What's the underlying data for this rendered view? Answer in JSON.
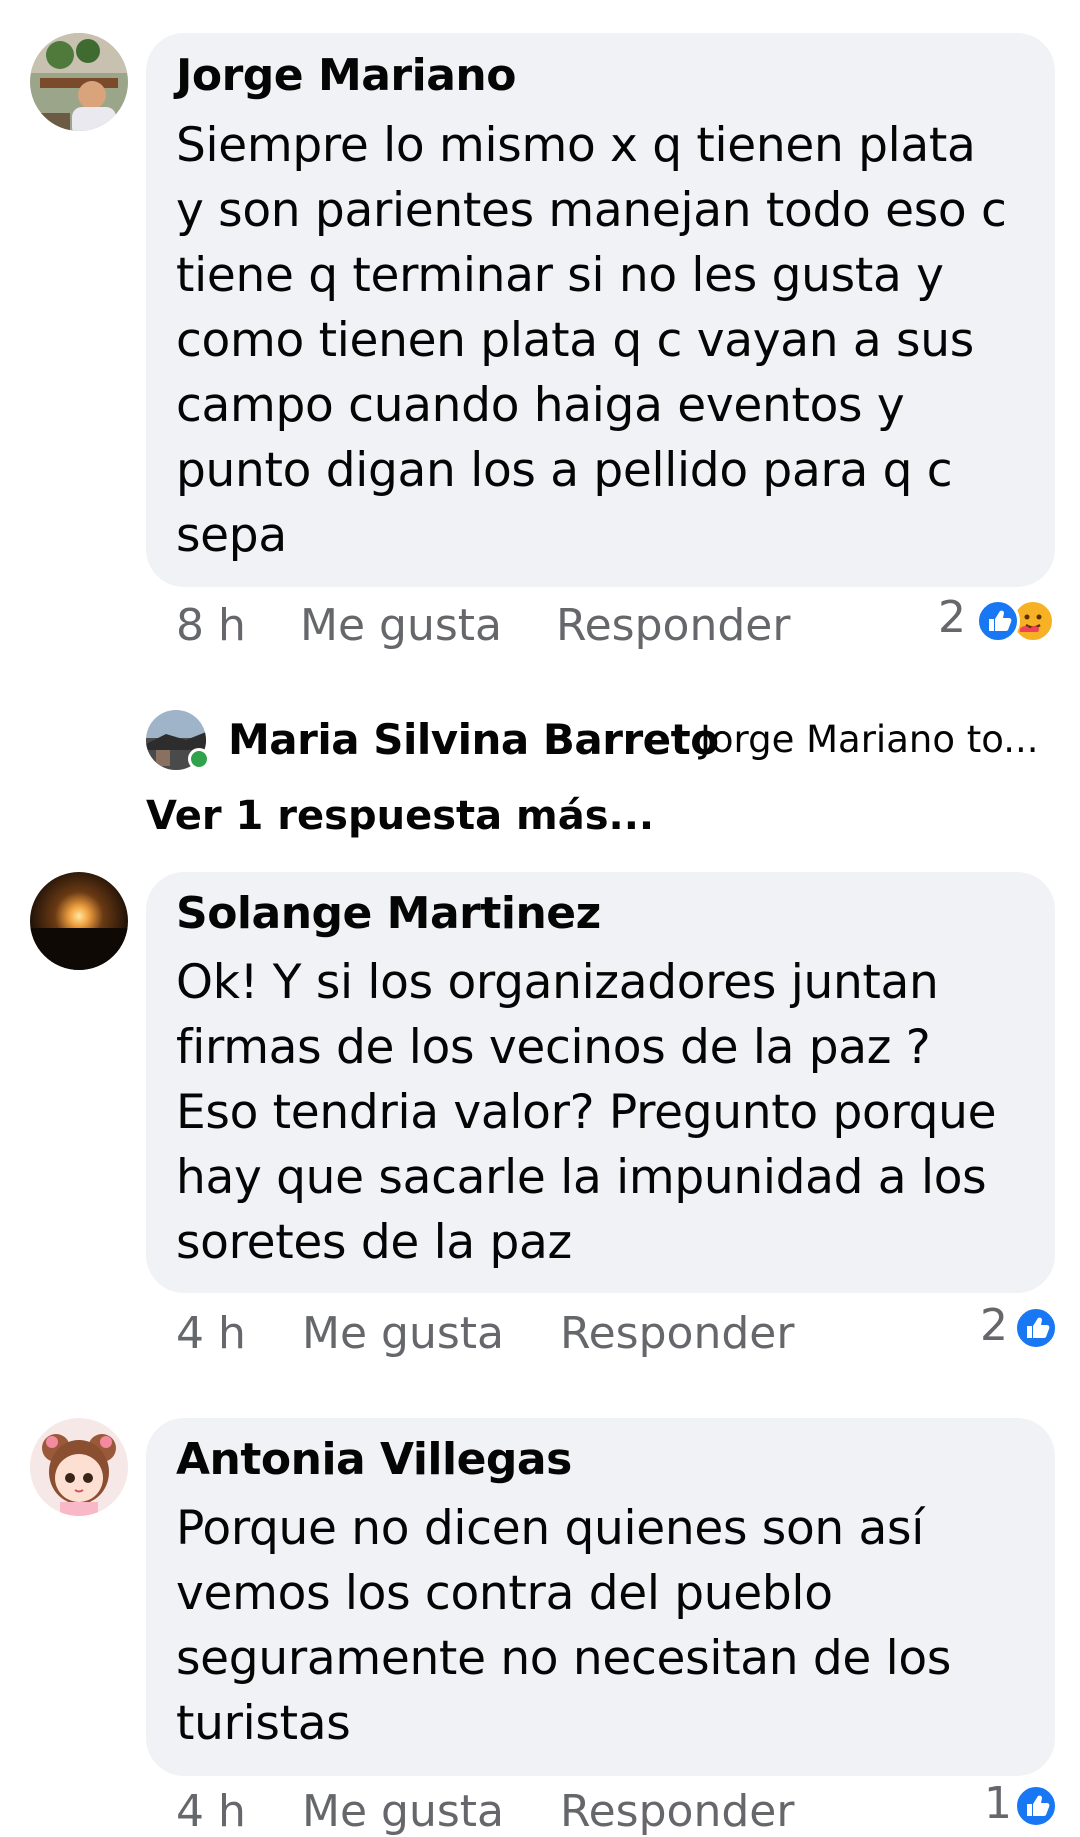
{
  "comments": [
    {
      "author": "Jorge Mariano",
      "text": "Siempre lo mismo x q tienen plata\ny son parientes manejan todo eso c\ntiene q terminar si no les gusta y\ncomo tienen plata q c vayan a sus\ncampo cuando haiga eventos y\npunto digan los a pellido para q c\nsepa",
      "time": "8 h",
      "like_label": "Me gusta",
      "reply_label": "Responder",
      "reaction_count": "2",
      "reactions": [
        "like-icon",
        "care-icon"
      ]
    },
    {
      "author": "Solange Martinez",
      "text": "Ok! Y si los organizadores juntan\nfirmas de los vecinos de la paz ?\nEso tendria valor? Pregunto porque\nhay que sacarle la impunidad a los\nsoretes de la paz",
      "time": "4 h",
      "like_label": "Me gusta",
      "reply_label": "Responder",
      "reaction_count": "2",
      "reactions": [
        "like-icon"
      ]
    },
    {
      "author": "Antonia Villegas",
      "text": "Porque no dicen quienes son así\nvemos los contra del pueblo\nseguramente no necesitan de los\nturistas",
      "time": "4 h",
      "like_label": "Me gusta",
      "reply_label": "Responder",
      "reaction_count": "1",
      "reactions": [
        "like-icon"
      ]
    }
  ],
  "reply_preview": {
    "author": "Maria Silvina Barreto",
    "snippet": "Jorge Mariano to..."
  },
  "more_replies_label": "Ver 1 respuesta más...",
  "colors": {
    "bubble": "#f0f2f5",
    "meta_text": "#65676b",
    "like_blue": "#1877f2",
    "online_green": "#31a24c"
  }
}
